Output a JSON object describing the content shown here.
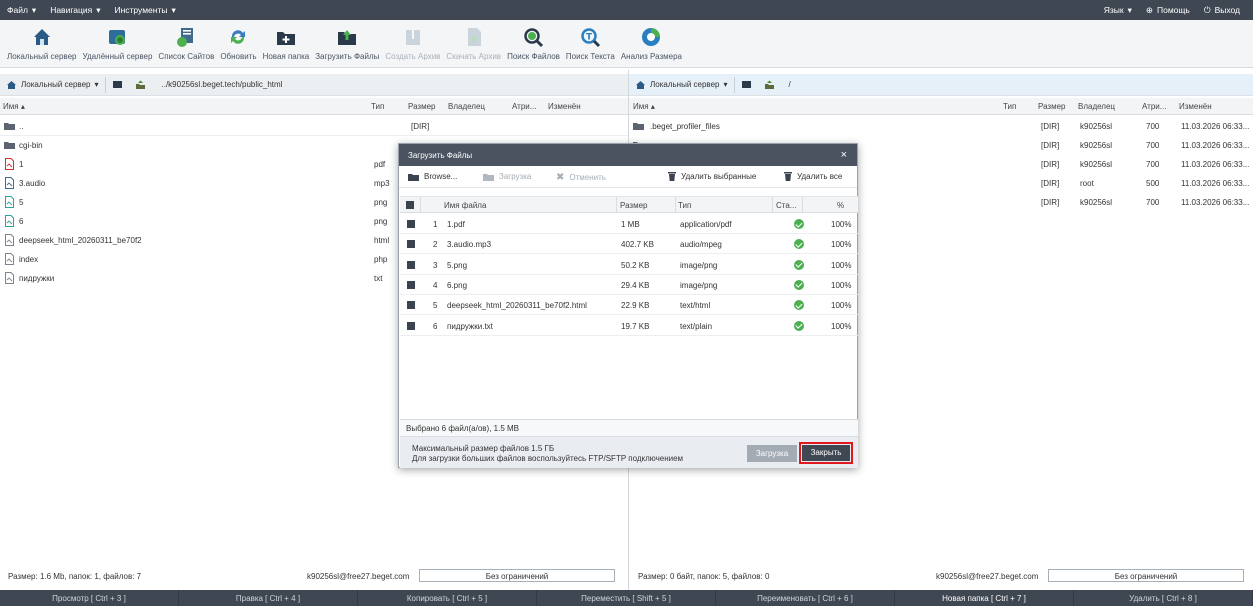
{
  "menubar": {
    "left": [
      "Файл",
      "Навигация",
      "Инструменты"
    ],
    "lang": "Язык",
    "help": "Помощь",
    "exit": "Выход"
  },
  "toolbar": [
    {
      "label": "Локальный сервер",
      "icon": "home-icon",
      "enabled": true
    },
    {
      "label": "Удалённый сервер",
      "icon": "remote-server-icon",
      "enabled": true
    },
    {
      "label": "Список Сайтов",
      "icon": "site-list-icon",
      "enabled": true
    },
    {
      "label": "Обновить",
      "icon": "refresh-icon",
      "enabled": true
    },
    {
      "label": "Новая папка",
      "icon": "new-folder-icon",
      "enabled": true
    },
    {
      "label": "Загрузить Файлы",
      "icon": "upload-icon",
      "enabled": true
    },
    {
      "label": "Создать Архив",
      "icon": "archive-icon",
      "enabled": false
    },
    {
      "label": "Скачать Архив",
      "icon": "download-archive-icon",
      "enabled": false
    },
    {
      "label": "Поиск Файлов",
      "icon": "search-files-icon",
      "enabled": true
    },
    {
      "label": "Поиск Текста",
      "icon": "search-text-icon",
      "enabled": true
    },
    {
      "label": "Анализ Размера",
      "icon": "size-analysis-icon",
      "enabled": true
    }
  ],
  "left": {
    "server": "Локальный сервер",
    "path": "../k90256sl.beget.tech/public_html",
    "columns": {
      "name": "Имя",
      "type": "Тип",
      "size": "Размер",
      "owner": "Владелец",
      "attr": "Атри...",
      "modified": "Изменён"
    },
    "rows": [
      {
        "name": "..",
        "type": "",
        "size": "[DIR]",
        "kind": "folder"
      },
      {
        "name": "cgi-bin",
        "type": "",
        "size": "",
        "kind": "folder"
      },
      {
        "name": "1",
        "type": "pdf",
        "size": "",
        "kind": "pdf"
      },
      {
        "name": "3.audio",
        "type": "mp3",
        "size": "",
        "kind": "audio"
      },
      {
        "name": "5",
        "type": "png",
        "size": "",
        "kind": "image"
      },
      {
        "name": "6",
        "type": "png",
        "size": "",
        "kind": "image"
      },
      {
        "name": "deepseek_html_20260311_be70f2",
        "type": "html",
        "size": "",
        "kind": "doc"
      },
      {
        "name": "index",
        "type": "php",
        "size": "",
        "kind": "doc"
      },
      {
        "name": "пидружки",
        "type": "txt",
        "size": "",
        "kind": "doc"
      }
    ],
    "status": "Размер: 1.6 Mb, папок: 1, файлов: 7",
    "user": "k90256sl@free27.beget.com",
    "limit": "Без ограничений"
  },
  "right": {
    "server": "Локальный сервер",
    "path": "/",
    "columns": {
      "name": "Имя",
      "type": "Тип",
      "size": "Размер",
      "owner": "Владелец",
      "attr": "Атри...",
      "modified": "Изменён"
    },
    "rows": [
      {
        "name": ".beget_profiler_files",
        "size": "[DIR]",
        "owner": "k90256sl",
        "attr": "700",
        "modified": "11.03.2026 06:33..."
      },
      {
        "name": "",
        "size": "[DIR]",
        "owner": "k90256sl",
        "attr": "700",
        "modified": "11.03.2026 06:33..."
      },
      {
        "name": "",
        "size": "[DIR]",
        "owner": "k90256sl",
        "attr": "700",
        "modified": "11.03.2026 06:33..."
      },
      {
        "name": "",
        "size": "[DIR]",
        "owner": "root",
        "attr": "500",
        "modified": "11.03.2026 06:33..."
      },
      {
        "name": "",
        "size": "[DIR]",
        "owner": "k90256sl",
        "attr": "700",
        "modified": "11.03.2026 06:33..."
      }
    ],
    "status": "Размер: 0 байт, папок: 5, файлов: 0",
    "user": "k90256sl@free27.beget.com",
    "limit": "Без ограничений"
  },
  "fnbar": [
    {
      "label": "Просмотр [ Ctrl + 3 ]",
      "active": false
    },
    {
      "label": "Правка [ Ctrl + 4 ]",
      "active": false
    },
    {
      "label": "Копировать [ Ctrl + 5 ]",
      "active": false
    },
    {
      "label": "Переместить [ Shift + 5 ]",
      "active": false
    },
    {
      "label": "Переименовать [ Ctrl + 6 ]",
      "active": false
    },
    {
      "label": "Новая папка [ Ctrl + 7 ]",
      "active": true
    },
    {
      "label": "Удалить [ Ctrl + 8 ]",
      "active": false
    }
  ],
  "dialog": {
    "title": "Загрузить Файлы",
    "close": "×",
    "tools": {
      "browse": "Browse...",
      "upload": "Загрузка",
      "cancel": "Отменить",
      "delete_selected": "Удалить выбранные",
      "delete_all": "Удалить все"
    },
    "columns": {
      "name": "Имя файла",
      "size": "Размер",
      "type": "Тип",
      "status": "Ста...",
      "percent": "%"
    },
    "files": [
      {
        "n": "1",
        "name": "1.pdf",
        "size": "1 MB",
        "type": "application/pdf",
        "percent": "100%"
      },
      {
        "n": "2",
        "name": "3.audio.mp3",
        "size": "402.7 KB",
        "type": "audio/mpeg",
        "percent": "100%"
      },
      {
        "n": "3",
        "name": "5.png",
        "size": "50.2 KB",
        "type": "image/png",
        "percent": "100%"
      },
      {
        "n": "4",
        "name": "6.png",
        "size": "29.4 KB",
        "type": "image/png",
        "percent": "100%"
      },
      {
        "n": "5",
        "name": "deepseek_html_20260311_be70f2.html",
        "size": "22.9 KB",
        "type": "text/html",
        "percent": "100%"
      },
      {
        "n": "6",
        "name": "пидружки.txt",
        "size": "19.7 KB",
        "type": "text/plain",
        "percent": "100%"
      }
    ],
    "selected": "Выбрано 6 файл(а/ов), 1.5 MB",
    "footer_line1": "Максимальный размер файлов 1.5 ГБ",
    "footer_line2": "Для загрузки больших файлов воспользуйтесь FTP/SFTP подключением",
    "btn_upload": "Загрузка",
    "btn_close": "Закрыть"
  }
}
